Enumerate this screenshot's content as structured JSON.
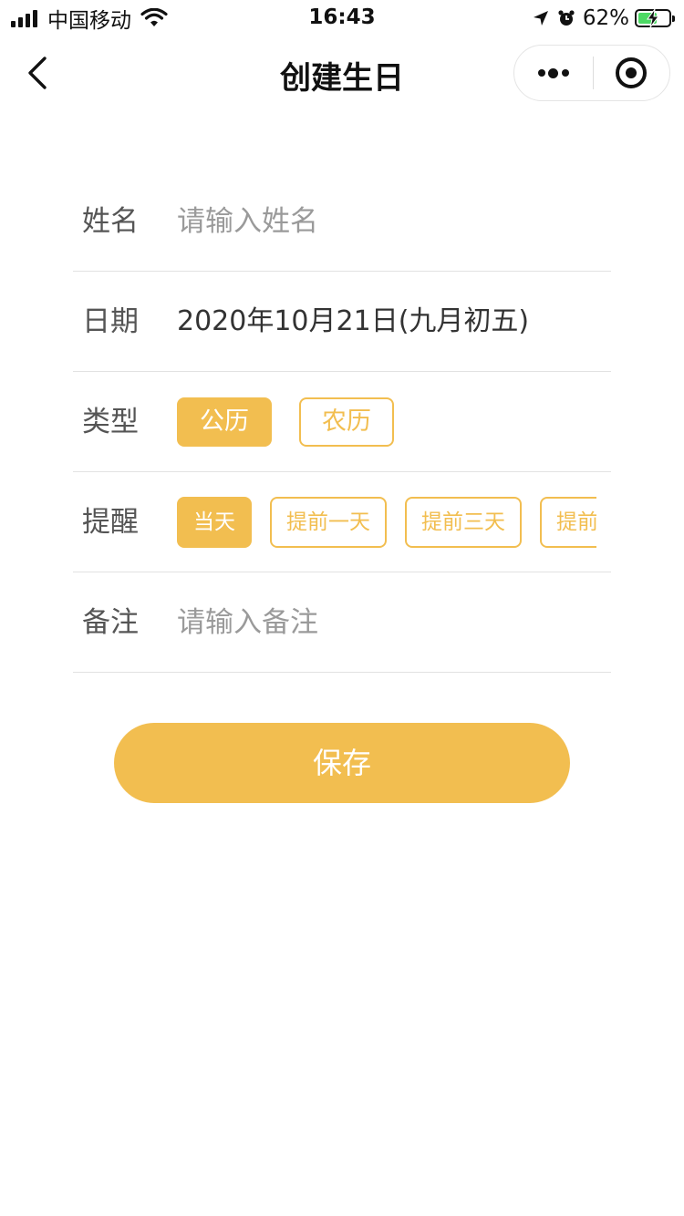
{
  "status_bar": {
    "carrier": "中国移动",
    "time": "16:43",
    "battery_percent": "62%",
    "battery_level": 0.62,
    "icons": [
      "signal-icon",
      "wifi-icon",
      "location-arrow-icon",
      "alarm-icon",
      "battery-charging-icon"
    ]
  },
  "nav": {
    "title": "创建生日",
    "icons": [
      "back-chevron-icon",
      "more-dots-icon",
      "close-target-icon"
    ]
  },
  "form": {
    "name": {
      "label": "姓名",
      "placeholder": "请输入姓名",
      "value": ""
    },
    "date": {
      "label": "日期",
      "value": "2020年10月21日(九月初五)"
    },
    "type": {
      "label": "类型",
      "options": [
        "公历",
        "农历"
      ],
      "selected": "公历"
    },
    "remind": {
      "label": "提醒",
      "options": [
        "当天",
        "提前一天",
        "提前三天",
        "提前一周"
      ],
      "selected": "当天"
    },
    "note": {
      "label": "备注",
      "placeholder": "请输入备注",
      "value": ""
    }
  },
  "save_label": "保存",
  "colors": {
    "accent": "#f2be50",
    "divider": "#e2e2e2",
    "label": "#555555",
    "placeholder": "#9a9a9a",
    "battery_fill": "#4cd964"
  }
}
